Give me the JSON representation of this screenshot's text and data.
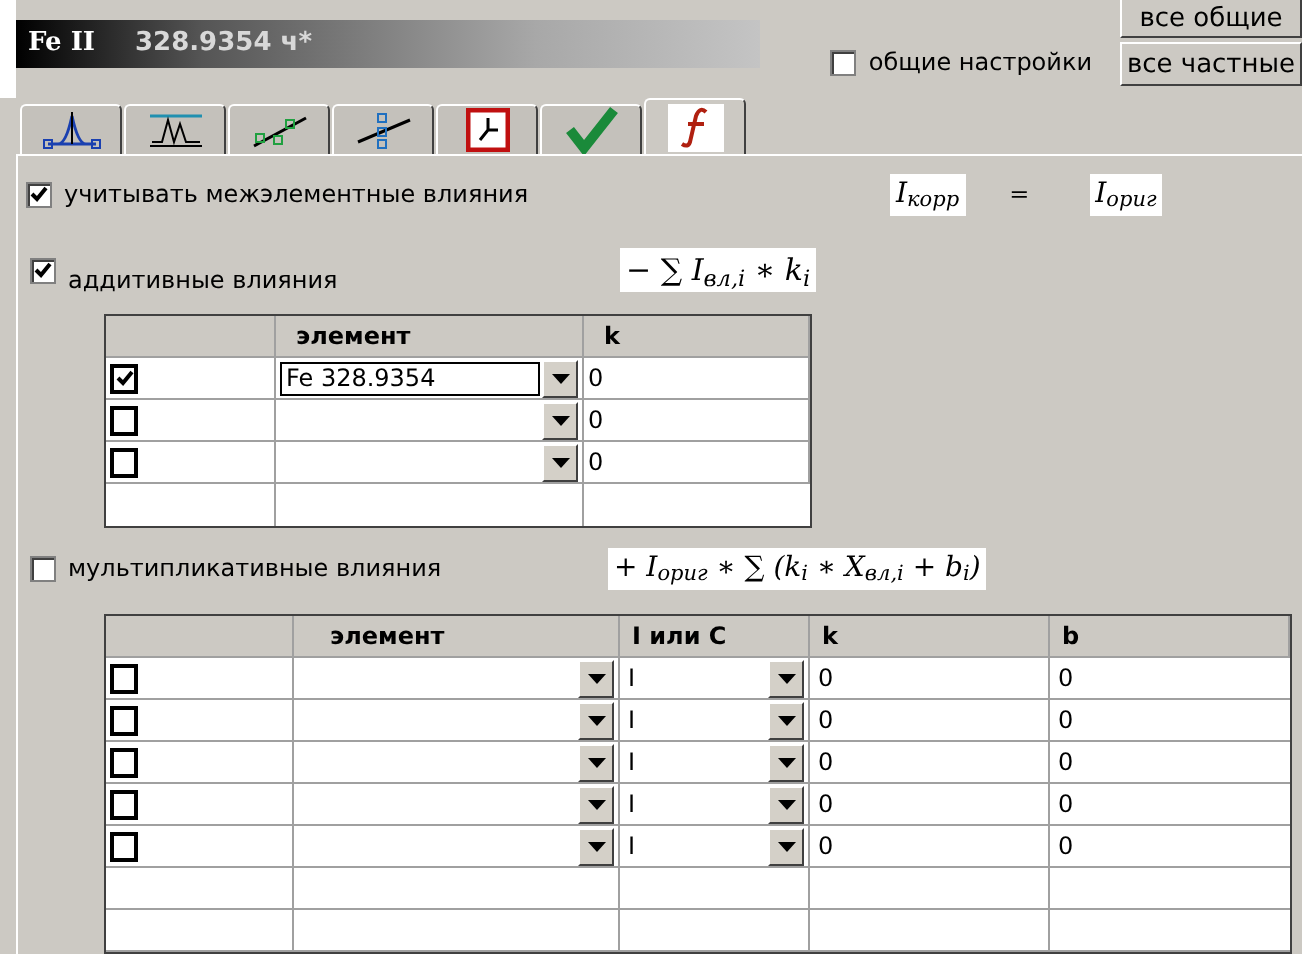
{
  "header": {
    "title": "Fe II",
    "subtitle": "328.9354 ч*"
  },
  "general_settings": {
    "label": "общие настройки",
    "checked": false
  },
  "buttons": [
    "все общие",
    "все частные"
  ],
  "tabs": [
    {
      "kind": "peak",
      "selected": false
    },
    {
      "kind": "baseline",
      "selected": false
    },
    {
      "kind": "curve",
      "selected": false
    },
    {
      "kind": "line",
      "selected": false
    },
    {
      "kind": "clock",
      "selected": false
    },
    {
      "kind": "check",
      "selected": false
    },
    {
      "kind": "function",
      "selected": true
    }
  ],
  "interelement": {
    "label": "учитывать межэлементные влияния",
    "checked": true,
    "formula_left": "I$_{корр}$",
    "equals": "=",
    "formula_right": "I$_{ориг}$"
  },
  "additive": {
    "label": "аддитивные влияния",
    "checked": true,
    "formula": "− ∑ I$_{вл,i}$ ∗ k$_{i}$",
    "columns": [
      "элемент",
      "k"
    ],
    "rows": [
      {
        "checked": true,
        "element": "Fe 328.9354",
        "focused": true,
        "k": "0"
      },
      {
        "checked": false,
        "element": "",
        "focused": false,
        "k": "0"
      },
      {
        "checked": false,
        "element": "",
        "focused": false,
        "k": "0"
      }
    ]
  },
  "multiplicative": {
    "label": "мультипликативные влияния",
    "checked": false,
    "formula": "+ I$_{ориг}$ ∗ ∑ (k$_{i}$ ∗ X$_{вл,i}$ + b$_{i}$)",
    "columns": [
      "элемент",
      "I или C",
      "k",
      "b"
    ],
    "rows": [
      {
        "checked": false,
        "element": "",
        "mode": "I",
        "k": "0",
        "b": "0"
      },
      {
        "checked": false,
        "element": "",
        "mode": "I",
        "k": "0",
        "b": "0"
      },
      {
        "checked": false,
        "element": "",
        "mode": "I",
        "k": "0",
        "b": "0"
      },
      {
        "checked": false,
        "element": "",
        "mode": "I",
        "k": "0",
        "b": "0"
      },
      {
        "checked": false,
        "element": "",
        "mode": "I",
        "k": "0",
        "b": "0"
      }
    ]
  }
}
